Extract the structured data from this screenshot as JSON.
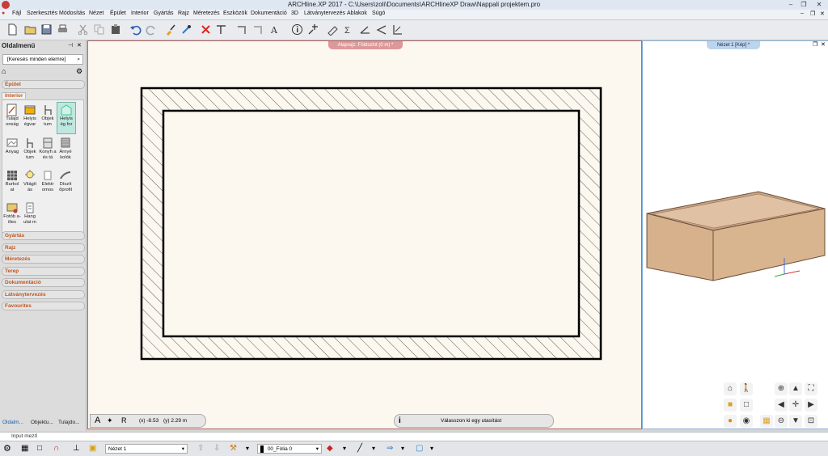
{
  "window": {
    "title": "ARCHline.XP 2017 - C:\\Users\\zoli\\Documents\\ARCHlineXP Draw\\Nappali projektem.pro",
    "minimize": "–",
    "maximize": "❐",
    "close": "✕"
  },
  "menu": [
    "Fájl",
    "Szerkesztés",
    "Módosítás",
    "Nézet",
    "Épület",
    "Interior",
    "Gyártás",
    "Rajz",
    "Méretezés",
    "Eszközök",
    "Dokumentáció",
    "3D",
    "Látványtervezés",
    "Ablakok",
    "Súgó"
  ],
  "side_panel": {
    "title": "Oldalmenü",
    "search_placeholder": "[Keresés minden elemre]",
    "categories_top": [
      "Épület"
    ],
    "active_category": "Interior",
    "tools": [
      {
        "label": "Tulajd onság",
        "icon": "properties-icon"
      },
      {
        "label": "Helyis égvar",
        "icon": "room-icon"
      },
      {
        "label": "Objek tum",
        "icon": "chair-icon"
      },
      {
        "label": "Helyis ég for",
        "icon": "room-shape-icon"
      },
      {
        "label": "Anyag",
        "icon": "material-icon"
      },
      {
        "label": "Objek tum",
        "icon": "furniture-icon"
      },
      {
        "label": "Konyh a és tá",
        "icon": "kitchen-icon"
      },
      {
        "label": "Árnyé kolók",
        "icon": "shade-icon"
      },
      {
        "label": "Burkol at",
        "icon": "tiling-icon"
      },
      {
        "label": "Világít ás",
        "icon": "lighting-icon"
      },
      {
        "label": "Elektr omos",
        "icon": "electric-icon"
      },
      {
        "label": "Díszít őprofil",
        "icon": "molding-icon"
      },
      {
        "label": "Fotób a-illes",
        "icon": "photo-icon"
      },
      {
        "label": "Hang ulat m",
        "icon": "mood-icon"
      }
    ],
    "categories_bottom": [
      "Gyártás",
      "Rajz",
      "Méretezés",
      "Terep",
      "Dokumentáció",
      "Látványtervezés",
      "Favourites"
    ],
    "bottom_tabs": [
      "Oldalm...",
      "Objektu...",
      "Tulajdo..."
    ]
  },
  "canvas": {
    "tab": "Alaprajz: Földszint (0 m) *",
    "coord_x": "(x) -8.53",
    "coord_y": "(y) 2.29 m",
    "status_hint": "Válasszon ki egy utasítást"
  },
  "view3d": {
    "tab": "Nézet 1 [Kép] *"
  },
  "input_row": {
    "label": "Input mező"
  },
  "bottom_bar": {
    "view_select": "Nézet 1",
    "layer_select": "00_Fólia 0"
  },
  "colors": {
    "accent": "#c0561e",
    "canvas_bg": "#fcf7ef",
    "wall": "#000000",
    "box_top": "#c9a384",
    "box_side": "#d8b48f"
  }
}
